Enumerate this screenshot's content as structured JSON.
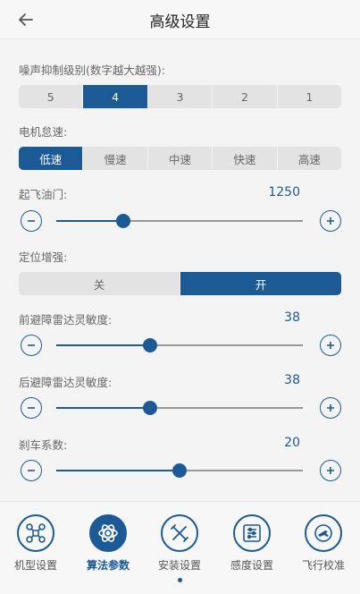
{
  "header": {
    "title": "高级设置",
    "back_icon": "arrow-left-icon"
  },
  "noise": {
    "label": "噪声抑制级别(数字越大越强):",
    "options": [
      "5",
      "4",
      "3",
      "2",
      "1"
    ],
    "selected": "4"
  },
  "motor_idle": {
    "label": "电机怠速:",
    "options": [
      "低速",
      "慢速",
      "中速",
      "快速",
      "高速"
    ],
    "selected": "低速"
  },
  "takeoff_throttle": {
    "label": "起飞油门:",
    "value": "1250",
    "fraction": 0.27
  },
  "positioning": {
    "label": "定位增强:",
    "options": [
      "关",
      "开"
    ],
    "selected": "开"
  },
  "front_radar": {
    "label": "前避障雷达灵敏度:",
    "value": "38",
    "fraction": 0.38
  },
  "rear_radar": {
    "label": "后避障雷达灵敏度:",
    "value": "38",
    "fraction": 0.38
  },
  "brake": {
    "label": "刹车系数:",
    "value": "20",
    "fraction": 0.5
  },
  "nav": {
    "items": [
      {
        "label": "机型设置",
        "icon": "drone-icon"
      },
      {
        "label": "算法参数",
        "icon": "algorithm-icon"
      },
      {
        "label": "安装设置",
        "icon": "tools-icon"
      },
      {
        "label": "感度设置",
        "icon": "sliders-icon"
      },
      {
        "label": "飞行校准",
        "icon": "calibration-icon"
      }
    ],
    "active": "算法参数"
  },
  "colors": {
    "accent": "#1c5a96",
    "track": "#999999",
    "segment_bg": "#e3e3e3"
  }
}
